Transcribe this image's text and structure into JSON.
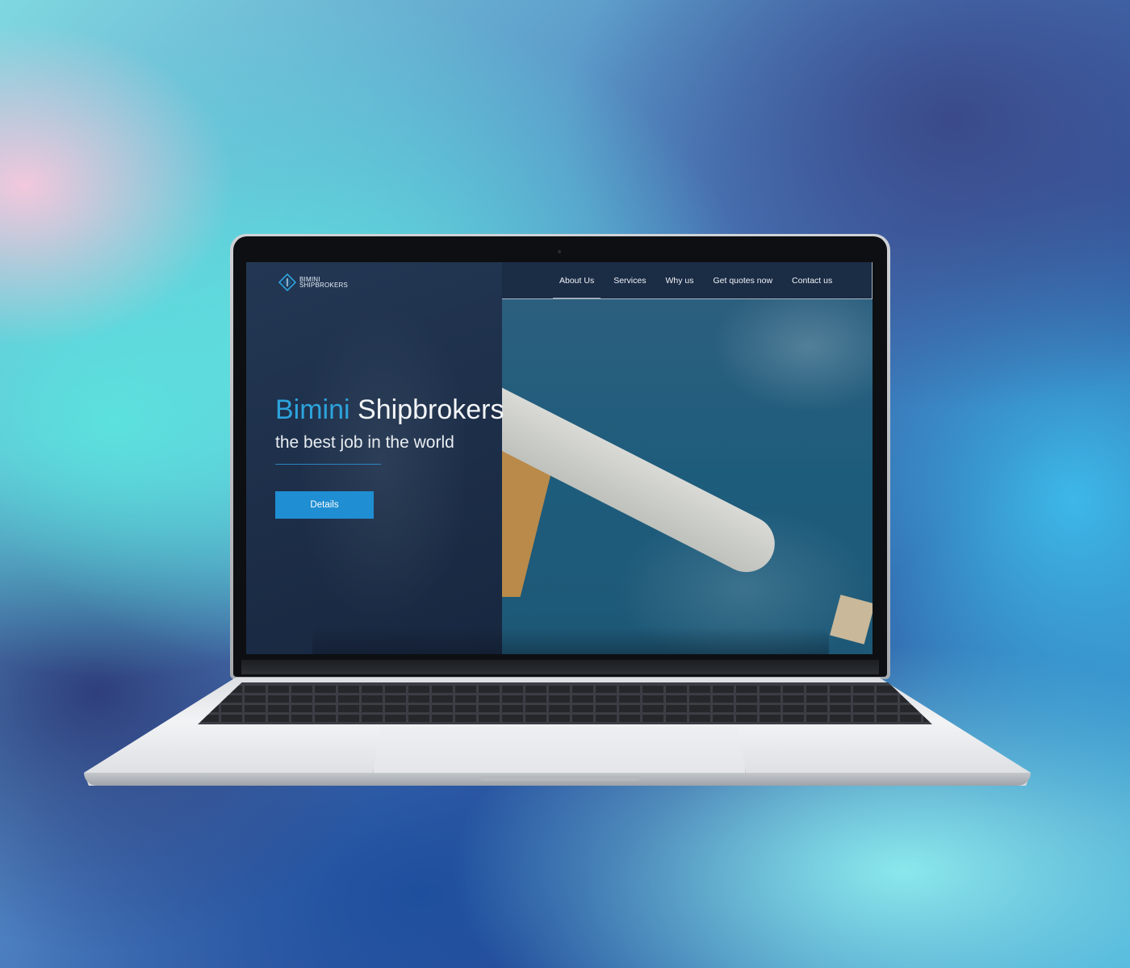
{
  "site": {
    "logo": {
      "line1": "BIMINI",
      "line2": "SHIPBROKERS"
    },
    "nav": [
      {
        "label": "About Us"
      },
      {
        "label": "Services"
      },
      {
        "label": "Why us"
      },
      {
        "label": "Get quotes now"
      },
      {
        "label": "Contact us"
      }
    ],
    "hero": {
      "title_accent": "Bimini",
      "title_rest": "Shipbrokers",
      "subtitle": "the best job in the world",
      "button_label": "Details"
    }
  },
  "colors": {
    "accent": "#2da3dc",
    "button": "#1f8ed2",
    "panel": "#1c2d47"
  },
  "icons": [
    "logo-diamond-icon"
  ]
}
